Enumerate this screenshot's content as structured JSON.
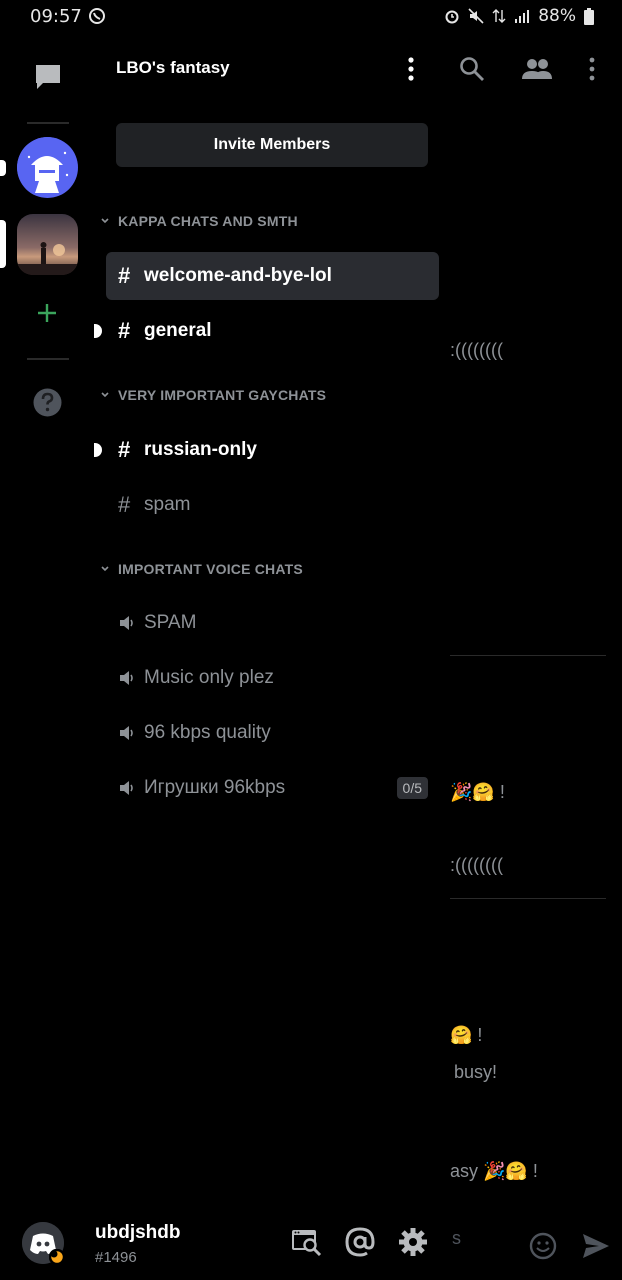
{
  "status_bar": {
    "time": "09:57",
    "battery": "88%"
  },
  "server": {
    "name": "LBO's fantasy"
  },
  "invite": {
    "label": "Invite Members"
  },
  "categories": [
    {
      "name": "KAPPA CHATS AND SMTH",
      "channels": [
        {
          "name": "welcome-and-bye-lol",
          "type": "text",
          "state": "active"
        },
        {
          "name": "general",
          "type": "text",
          "state": "unread"
        }
      ]
    },
    {
      "name": "VERY IMPORTANT GAYCHATS",
      "channels": [
        {
          "name": "russian-only",
          "type": "text",
          "state": "unread"
        },
        {
          "name": "spam",
          "type": "text",
          "state": "muted"
        }
      ]
    },
    {
      "name": "IMPORTANT VOICE CHATS",
      "channels": [
        {
          "name": "SPAM",
          "type": "voice"
        },
        {
          "name": "Music only plez",
          "type": "voice"
        },
        {
          "name": "96 kbps quality",
          "type": "voice"
        },
        {
          "name": "Игрушки 96kbps",
          "type": "voice",
          "badge": "0/5"
        }
      ]
    }
  ],
  "background_chat": {
    "snippets": [
      ":((((((((",
      "🎉🤗 !",
      ":((((((((",
      "🤗 !",
      "busy!",
      "asy 🎉🤗 !",
      "s"
    ]
  },
  "user": {
    "name": "ubdjshdb",
    "tag": "#1496"
  },
  "colors": {
    "active_bg": "#2a2c31",
    "muted_text": "#8e9297",
    "add_server": "#3ba55c",
    "blurple": "#5865f2",
    "status_idle": "#faa61a"
  }
}
